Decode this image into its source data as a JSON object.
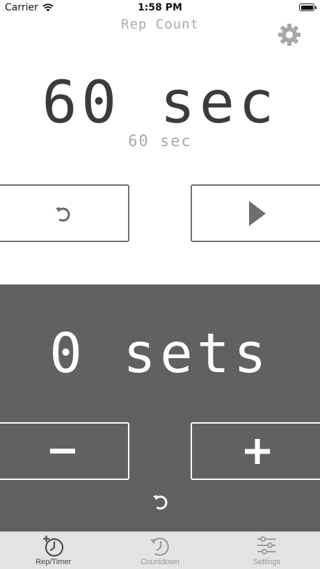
{
  "status_bar": {
    "carrier": "Carrier",
    "time": "1:58 PM"
  },
  "nav": {
    "title": "Rep Count",
    "settings_icon": "gear-icon"
  },
  "timer": {
    "main_display": "60 sec",
    "sub_display": "60 sec",
    "reset_icon": "reset-icon",
    "play_icon": "play-icon"
  },
  "sets": {
    "count_display": "0 sets",
    "minus_label": "−",
    "plus_label": "+",
    "reset_icon": "reset-icon"
  },
  "tabs": [
    {
      "label": "Rep/Timer",
      "icon": "rep-timer-icon",
      "active": true
    },
    {
      "label": "Countdown",
      "icon": "countdown-icon",
      "active": false
    },
    {
      "label": "Settings",
      "icon": "sliders-icon",
      "active": false
    }
  ],
  "colors": {
    "timer_text": "#3b3b3b",
    "secondary_text": "#a8a8a8",
    "sets_panel_bg": "#616161",
    "tab_bar_bg": "#e3e3e3",
    "button_border_top": "#6e6e6e",
    "button_border_bottom": "#ffffff"
  }
}
